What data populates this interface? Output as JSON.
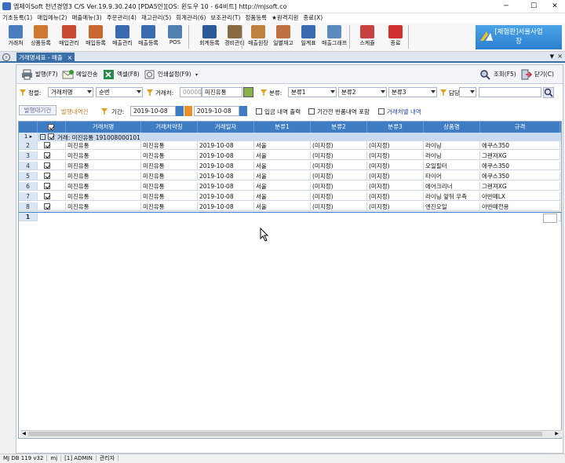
{
  "window": {
    "title": "엠제이Soft 천년경영3 C/S  Ver.19.9.30.240  [PDA5인][OS: 윈도우 10 - 64비트]   http://mjsoft.co",
    "minimize": "─",
    "maximize": "☐",
    "close": "✕"
  },
  "menu": [
    "기초등록(1)",
    "매입메뉴(2)",
    "매출메뉴(3)",
    "주문관리(4)",
    "재고관리(5)",
    "회계관리(6)",
    "보조관리(T)",
    "정품등록",
    "★원격지원",
    "종료(X)"
  ],
  "toolbar": [
    {
      "label": "거래처",
      "icon": "client-icon",
      "color": "#4a7cc0"
    },
    {
      "label": "상품등록",
      "icon": "product-icon",
      "color": "#d07830"
    },
    {
      "label": "매입관리",
      "icon": "purchase-icon",
      "color": "#c84830"
    },
    {
      "label": "매입등록",
      "icon": "purchase-register-icon",
      "color": "#c86830"
    },
    {
      "label": "매출관리",
      "icon": "sales-icon",
      "color": "#3a6ab0"
    },
    {
      "label": "매출등록",
      "icon": "sales-register-icon",
      "color": "#3a6ab0"
    },
    {
      "label": "POS",
      "icon": "pos-icon",
      "color": "#5080b0"
    },
    {
      "label": "회계등록",
      "icon": "accounting-icon",
      "color": "#2a5a9a"
    },
    {
      "label": "경비관리",
      "icon": "expense-icon",
      "color": "#8a6a40"
    },
    {
      "label": "매출원장",
      "icon": "ledger-icon",
      "color": "#c08040"
    },
    {
      "label": "일별재고",
      "icon": "daily-stock-icon",
      "color": "#c07040"
    },
    {
      "label": "일계표",
      "icon": "daily-report-icon",
      "color": "#3a6ab0"
    },
    {
      "label": "매출그래프",
      "icon": "graph-icon",
      "color": "#5a8ac0"
    },
    {
      "label": "스케쥴",
      "icon": "calendar-icon",
      "color": "#c84040"
    },
    {
      "label": "종료",
      "icon": "power-icon",
      "color": "#d03030"
    }
  ],
  "banner": {
    "line1": "[체험판]서울사업",
    "line2": "장"
  },
  "tab": {
    "label": "거래명세표 - 매출",
    "close": "×"
  },
  "subbar": {
    "print": "발행(F7)",
    "mail": "메일전송",
    "excel": "엑셀(F8)",
    "print_settings": "인쇄설정(F9)",
    "search": "조회(F5)",
    "close": "닫기(C)"
  },
  "filter": {
    "sort_label": "정렬:",
    "sort_value": "거래처명",
    "sort_order": "순번",
    "client_label": "거래처:",
    "client_code_placeholder": "000005",
    "client_name": "미진유통",
    "cat_label": "분류:",
    "cat1": "분류1",
    "cat2": "분류2",
    "cat3": "분류3",
    "manager_label": "담당:"
  },
  "filter2": {
    "tab_period": "발행대기건",
    "tab_issued": "발행내역건",
    "period_label": "기간:",
    "date_from": "2019-10-08",
    "date_to": "2019-10-08",
    "opt1": "입금 내역 출력",
    "opt2": "기간전 반품내역 포함",
    "opt3": "거래처별 내역"
  },
  "grid": {
    "headers": [
      "",
      "",
      "거래처명",
      "거래처약칭",
      "거래일자",
      "분류1",
      "분류2",
      "분류3",
      "상품명",
      "규격"
    ],
    "group_label": "거래: 미진유통 191008000101",
    "group_row_num": "1 ▸",
    "rows": [
      {
        "n": "2",
        "name": "미진유통",
        "short": "미진유통",
        "date": "2019-10-08",
        "c1": "서울",
        "c2": "(미지정)",
        "c3": "(미지정)",
        "product": "라이닝",
        "spec": "에쿠스350"
      },
      {
        "n": "3",
        "name": "미진유통",
        "short": "미진유통",
        "date": "2019-10-08",
        "c1": "서울",
        "c2": "(미지정)",
        "c3": "(미지정)",
        "product": "라이닝",
        "spec": "그랜져XG"
      },
      {
        "n": "4",
        "name": "미진유통",
        "short": "미진유통",
        "date": "2019-10-08",
        "c1": "서울",
        "c2": "(미지정)",
        "c3": "(미지정)",
        "product": "오일필터",
        "spec": "에쿠스350"
      },
      {
        "n": "5",
        "name": "미진유통",
        "short": "미진유통",
        "date": "2019-10-08",
        "c1": "서울",
        "c2": "(미지정)",
        "c3": "(미지정)",
        "product": "타이어",
        "spec": "에쿠스350"
      },
      {
        "n": "6",
        "name": "미진유통",
        "short": "미진유통",
        "date": "2019-10-08",
        "c1": "서울",
        "c2": "(미지정)",
        "c3": "(미지정)",
        "product": "에어크리너",
        "spec": "그랜져XG"
      },
      {
        "n": "7",
        "name": "미진유통",
        "short": "미진유통",
        "date": "2019-10-08",
        "c1": "서울",
        "c2": "(미지정)",
        "c3": "(미지정)",
        "product": "라이닝 앞뒤 우측",
        "spec": "아반떼LX"
      },
      {
        "n": "8",
        "name": "미진유통",
        "short": "미진유통",
        "date": "2019-10-08",
        "c1": "서울",
        "c2": "(미지정)",
        "c3": "(미지정)",
        "product": "엔진오일",
        "spec": "아반떼전용"
      }
    ],
    "footer_num": "1"
  },
  "status": [
    "MJ DB 119 v32",
    "mj",
    "[1] ADMIN",
    "관리자"
  ]
}
